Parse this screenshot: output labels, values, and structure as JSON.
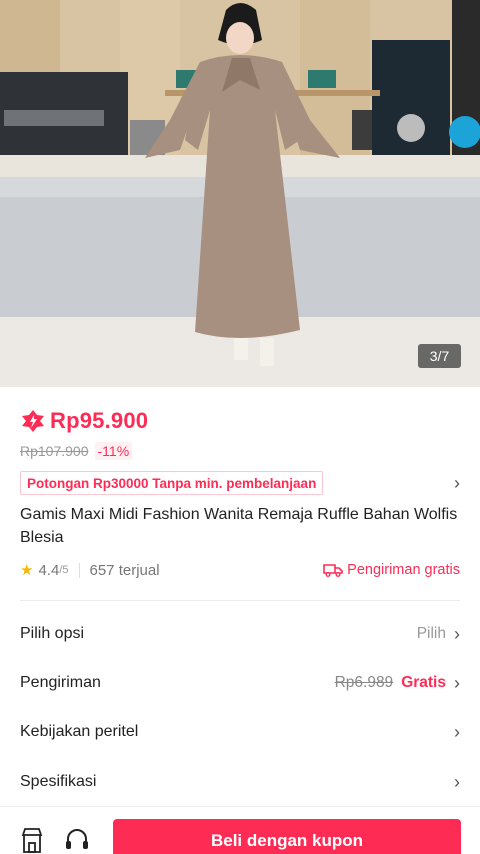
{
  "gallery": {
    "counter": "3/7"
  },
  "product": {
    "price": "Rp95.900",
    "original_price": "Rp107.900",
    "discount": "-11%",
    "coupon": "Potongan Rp30000 Tanpa min. pembelanjaan",
    "title": "Gamis Maxi Midi Fashion Wanita Remaja Ruffle Bahan Wolfis Blesia",
    "rating": "4.4",
    "rating_scale": "/5",
    "sold": "657 terjual",
    "free_shipping": "Pengiriman gratis"
  },
  "options": {
    "choose_label": "Pilih opsi",
    "choose_value": "Pilih",
    "shipping_label": "Pengiriman",
    "shipping_old": "Rp6.989",
    "shipping_free": "Gratis",
    "policy_label": "Kebijakan peritel",
    "spec_label": "Spesifikasi"
  },
  "bottom": {
    "buy_label": "Beli dengan kupon"
  },
  "icons": {
    "price_icon": "flash-sale-icon",
    "star": "star-icon",
    "truck": "truck-icon",
    "shop": "shop-icon",
    "support": "headset-icon",
    "chevron": "chevron-right-icon"
  },
  "colors": {
    "accent": "#fe2c55",
    "star": "#f6b800"
  }
}
